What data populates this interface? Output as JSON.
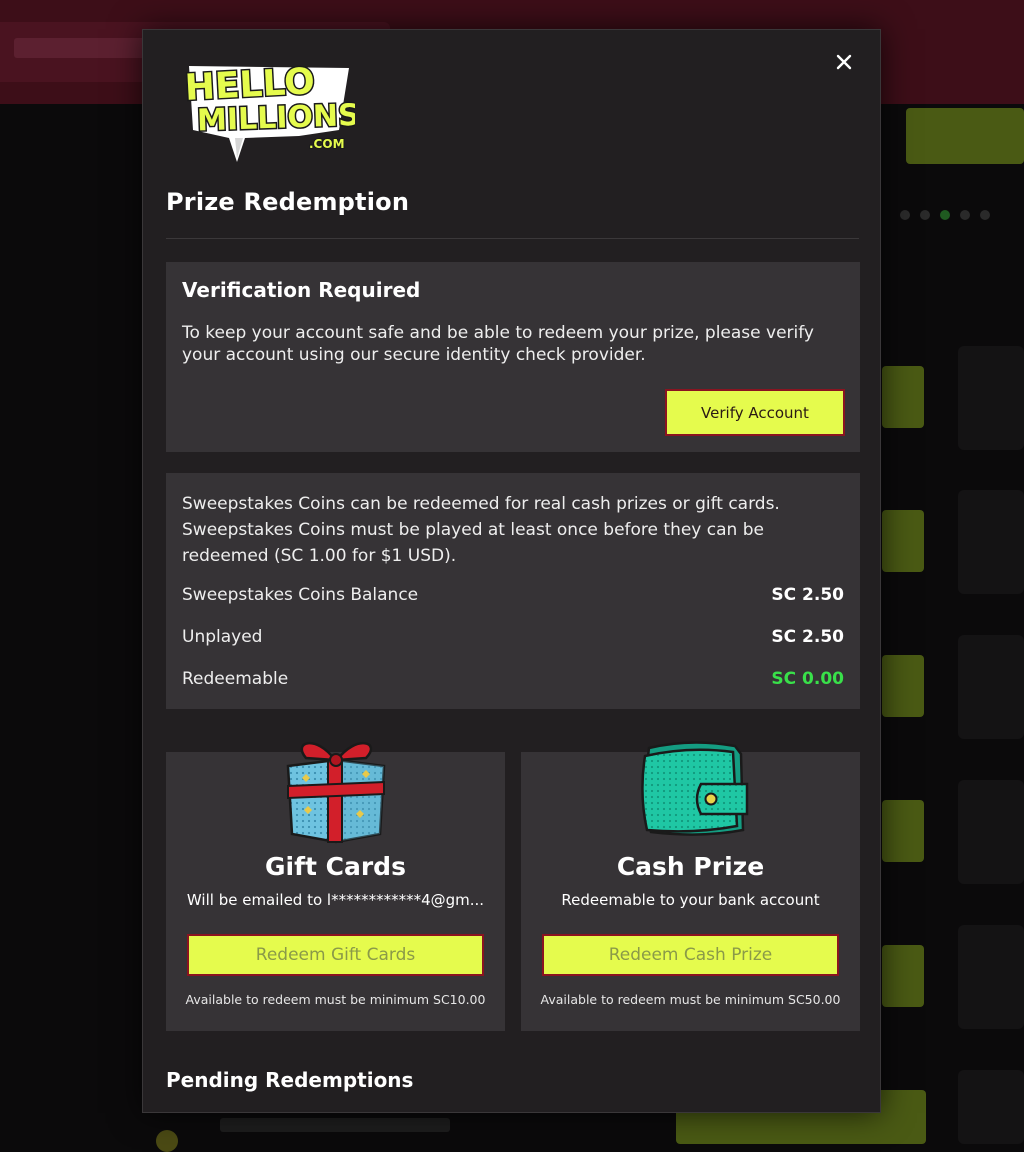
{
  "modal": {
    "logo_text": "HELLO MILLIONS .COM",
    "title": "Prize Redemption",
    "close_label": "×"
  },
  "verification": {
    "title": "Verification Required",
    "text": "To keep your account safe and be able to redeem your prize, please verify your account using our secure identity check provider.",
    "button_label": "Verify Account"
  },
  "info": {
    "text": "Sweepstakes Coins can be redeemed for real cash prizes or gift cards. Sweepstakes Coins must be played at least once before they can be redeemed (SC 1.00 for $1 USD).",
    "rows": [
      {
        "label": "Sweepstakes Coins Balance",
        "value": "SC 2.50"
      },
      {
        "label": "Unplayed",
        "value": "SC 2.50"
      },
      {
        "label": "Redeemable",
        "value": "SC 0.00"
      }
    ]
  },
  "options": [
    {
      "title": "Gift Cards",
      "subtitle": "Will be emailed to  l************4@gm...",
      "button_label": "Redeem Gift Cards",
      "note": "Available to redeem must be minimum SC10.00",
      "icon": "gift-box-icon"
    },
    {
      "title": "Cash Prize",
      "subtitle": "Redeemable to your bank account",
      "button_label": "Redeem Cash Prize",
      "note": "Available to redeem must be minimum SC50.00",
      "icon": "wallet-icon"
    }
  ],
  "pending": {
    "title": "Pending Redemptions"
  },
  "colors": {
    "accent_lime": "#e5fb4d",
    "button_border": "#8a1420",
    "redeemable_green": "#39e04a",
    "modal_bg": "#221f21",
    "panel_bg": "#363336"
  }
}
